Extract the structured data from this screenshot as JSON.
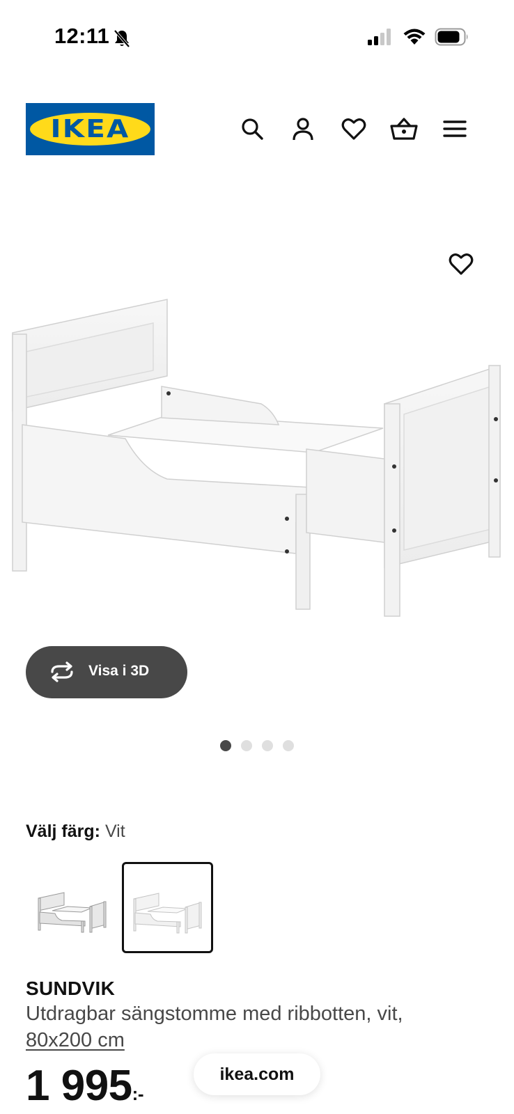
{
  "status_bar": {
    "time": "12:11",
    "icons": [
      "bell-slash-icon",
      "cellular-signal-icon",
      "wifi-icon",
      "battery-icon"
    ]
  },
  "header": {
    "logo_text": "IKEA",
    "brand_colors": {
      "blue": "#0058a3",
      "yellow": "#ffda1a"
    },
    "icons": [
      "search-icon",
      "user-icon",
      "heart-icon",
      "basket-icon",
      "menu-icon"
    ]
  },
  "product_gallery": {
    "view_3d_label": "Visa i 3D",
    "dot_count": 4,
    "active_dot": 0
  },
  "color_selection": {
    "label": "Välj färg:",
    "value": "Vit",
    "selected_index": 1
  },
  "product": {
    "name": "SUNDVIK",
    "description": "Utdragbar sängstomme med ribbotten, vit,",
    "size": "80x200 cm",
    "price": "1 995",
    "price_suffix": ":-"
  },
  "browser": {
    "url": "ikea.com"
  }
}
